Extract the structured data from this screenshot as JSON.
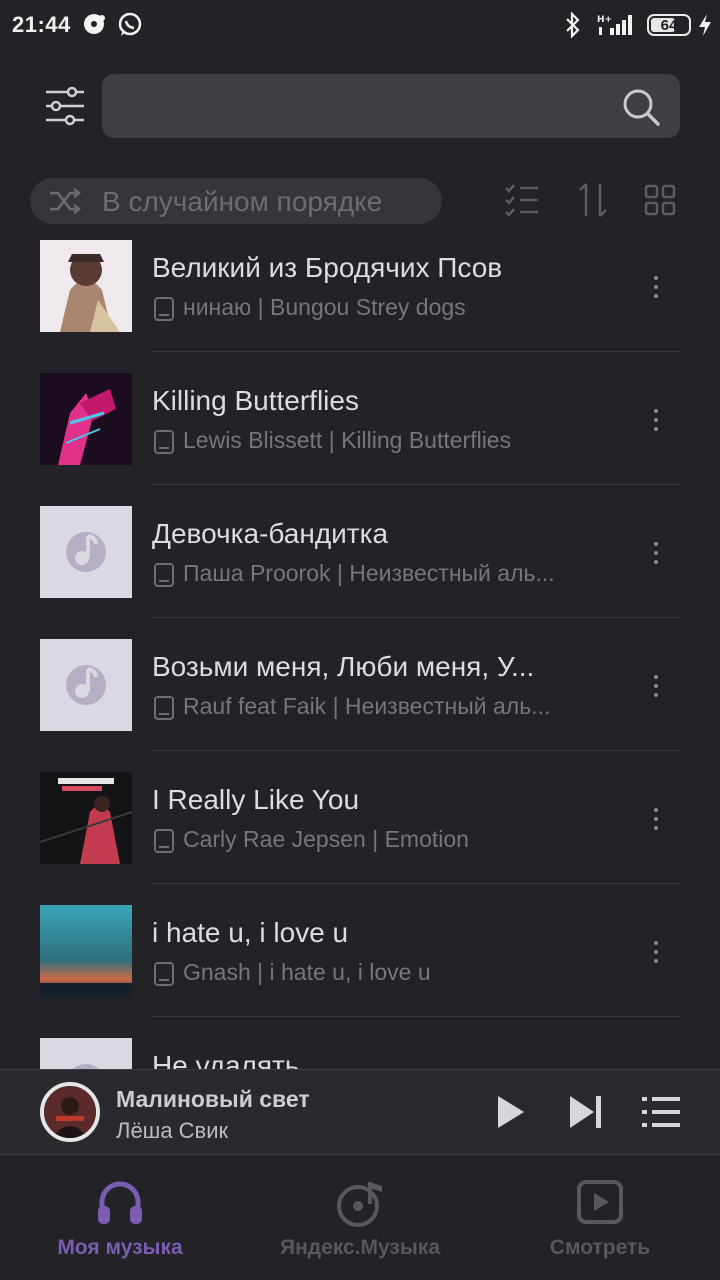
{
  "status_bar": {
    "time": "21:44",
    "battery": "64",
    "network": "H+"
  },
  "search": {
    "placeholder": ""
  },
  "controls": {
    "shuffle_label": "В случайном порядке"
  },
  "tracks": [
    {
      "title": "Великий из Бродячих Псов",
      "subtitle": "нинаю | Bungou Strey dogs",
      "cover": "art"
    },
    {
      "title": "Killing Butterflies",
      "subtitle": "Lewis Blissett | Killing Butterflies",
      "cover": "art"
    },
    {
      "title": "Девочка-бандитка",
      "subtitle": "Паша Proorok | Неизвестный аль...",
      "cover": "placeholder"
    },
    {
      "title": "Возьми меня, Люби меня, У...",
      "subtitle": "Rauf feat Faik | Неизвестный аль...",
      "cover": "placeholder"
    },
    {
      "title": "I Really Like You",
      "subtitle": "Carly Rae Jepsen | Emotion",
      "cover": "art"
    },
    {
      "title": "i hate u, i love u",
      "subtitle": "Gnash | i hate u, i love u",
      "cover": "art"
    },
    {
      "title": "Не удалять",
      "subtitle": "",
      "cover": "placeholder"
    }
  ],
  "player": {
    "title": "Малиновый свет",
    "artist": "Лёша Свик"
  },
  "nav": {
    "my_music": "Моя музыка",
    "yandex_music": "Яндекс.Музыка",
    "watch": "Смотреть"
  },
  "colors": {
    "accent": "#7a5db0",
    "background": "#232226",
    "placeholder_cover": "#dcd8e1"
  }
}
